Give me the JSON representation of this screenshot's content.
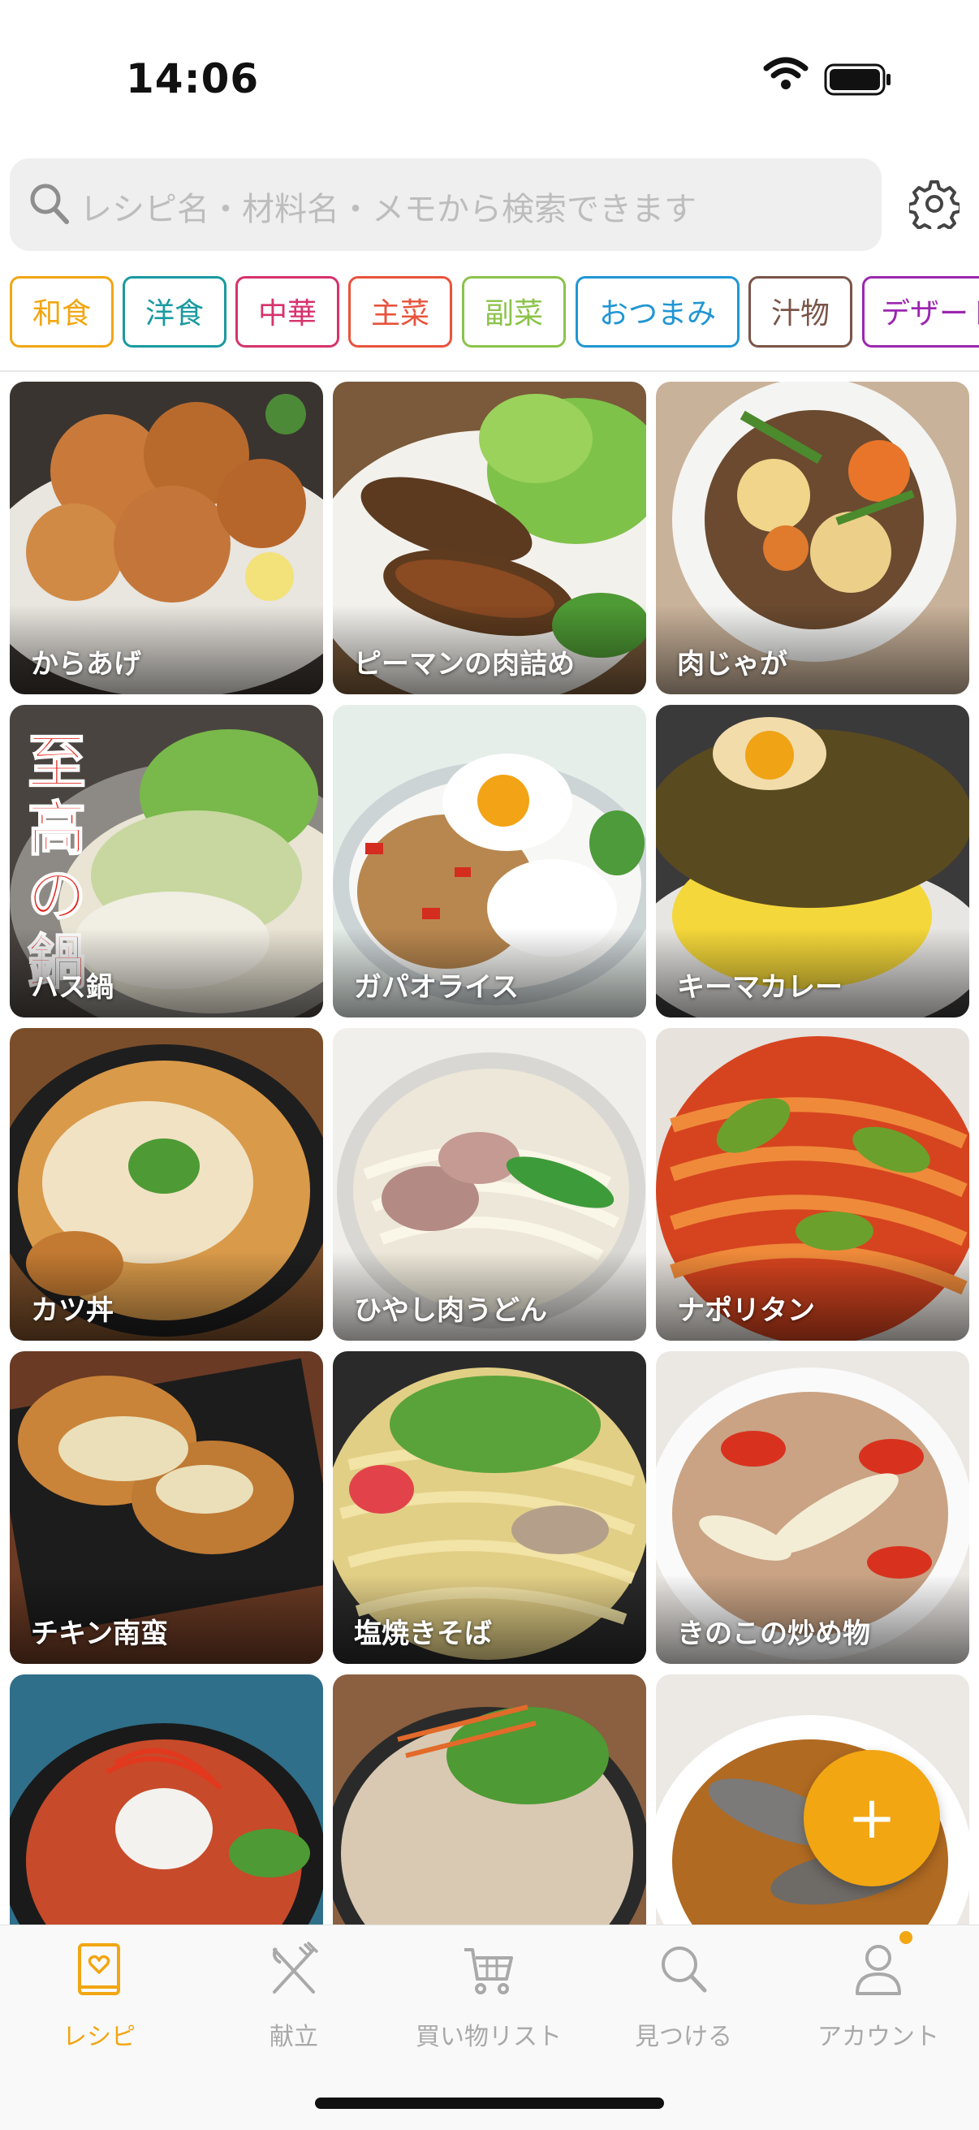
{
  "status": {
    "time": "14:06"
  },
  "search": {
    "placeholder": "レシピ名・材料名・メモから検索できます"
  },
  "categories": [
    {
      "label": "和食",
      "color": "#f2a612"
    },
    {
      "label": "洋食",
      "color": "#1a9aa0"
    },
    {
      "label": "中華",
      "color": "#d6336c"
    },
    {
      "label": "主菜",
      "color": "#e8533c"
    },
    {
      "label": "副菜",
      "color": "#8bc34a"
    },
    {
      "label": "おつまみ",
      "color": "#2196d3"
    },
    {
      "label": "汁物",
      "color": "#7a5548"
    },
    {
      "label": "デザート",
      "color": "#9c27b0"
    }
  ],
  "recipes": [
    {
      "name": "からあげ"
    },
    {
      "name": "ピーマンの肉詰め"
    },
    {
      "name": "肉じゃが"
    },
    {
      "name": "ハス鍋",
      "overlay_text": "至高の鍋"
    },
    {
      "name": "ガパオライス"
    },
    {
      "name": "キーマカレー"
    },
    {
      "name": "カツ丼"
    },
    {
      "name": "ひやし肉うどん"
    },
    {
      "name": "ナポリタン"
    },
    {
      "name": "チキン南蛮"
    },
    {
      "name": "塩焼きそば"
    },
    {
      "name": "きのこの炒め物"
    },
    {
      "name": ""
    },
    {
      "name": ""
    },
    {
      "name": ""
    }
  ],
  "fab": {
    "label": "+"
  },
  "tabs": [
    {
      "label": "レシピ",
      "icon": "recipe-book-icon",
      "active": true
    },
    {
      "label": "献立",
      "icon": "fork-knife-icon"
    },
    {
      "label": "買い物リスト",
      "icon": "cart-icon"
    },
    {
      "label": "見つける",
      "icon": "search-icon"
    },
    {
      "label": "アカウント",
      "icon": "person-icon"
    }
  ],
  "colors": {
    "accent": "#f2a612",
    "inactive": "#a9a9a9"
  }
}
